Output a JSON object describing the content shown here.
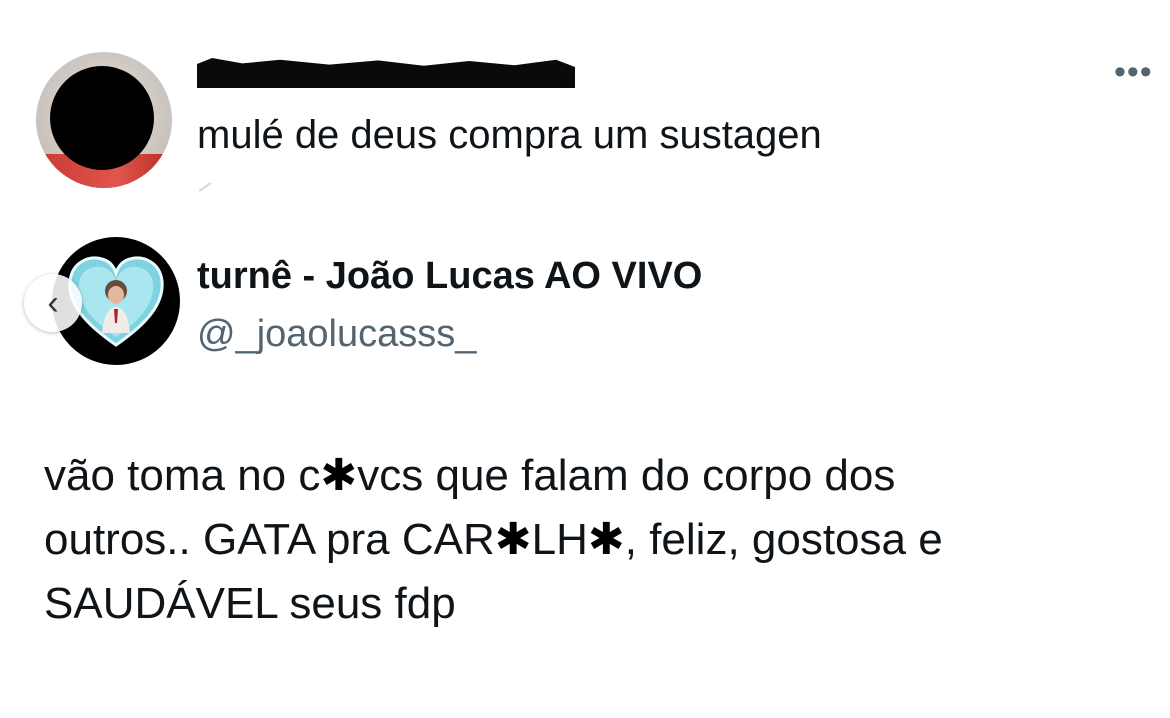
{
  "reply": {
    "author_name_redacted": true,
    "text": "mulé de deus compra um sustagen",
    "more_icon": "more-dots-icon",
    "more_label": "•••"
  },
  "tweet": {
    "display_name": "turnê - João Lucas AO VIVO",
    "handle": "@_joaolucasss_",
    "nav_icon": "chevron-left-icon",
    "nav_label": "‹",
    "body": {
      "line1_a": "vão toma no c",
      "line1_star": "✱",
      "line1_b": "vcs que falam do corpo dos",
      "line2_a": "outros.. GATA pra CAR",
      "line2_star1": "✱",
      "line2_b": "LH",
      "line2_star2": "✱",
      "line2_c": ", feliz, gostosa e",
      "line3": "SAUDÁVEL seus fdp"
    }
  },
  "colors": {
    "text_primary": "#0f1419",
    "text_secondary": "#536471",
    "background": "#ffffff",
    "heart_fill": "#7fd2e0"
  }
}
